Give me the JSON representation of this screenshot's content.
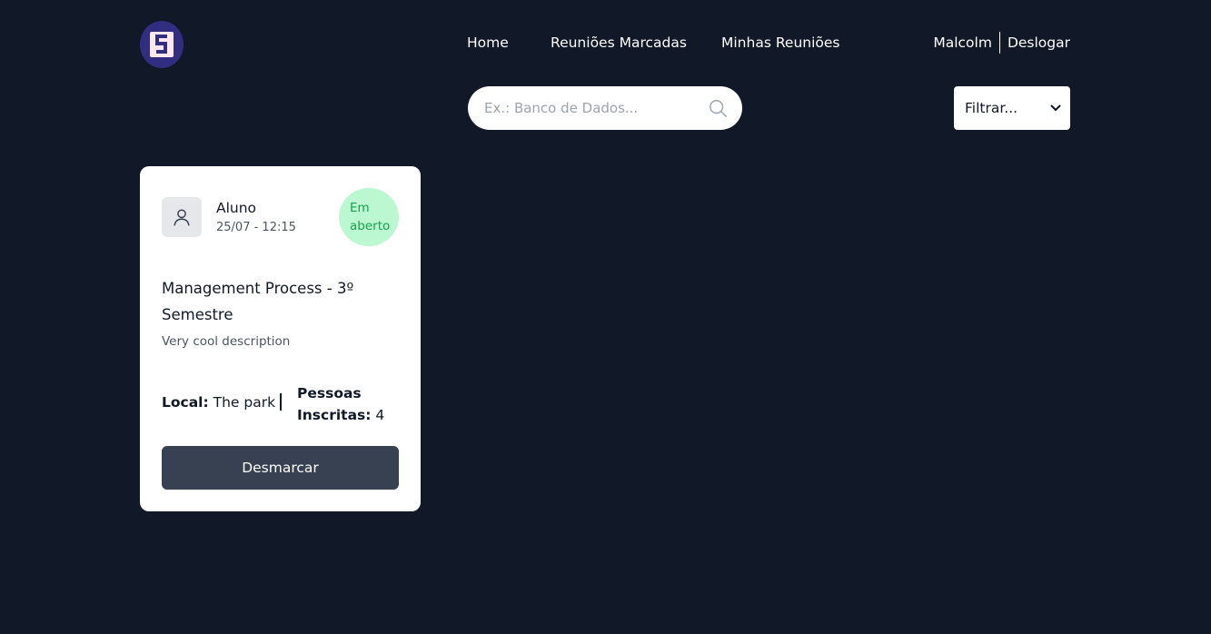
{
  "header": {
    "logo_icon": "app-logo",
    "nav": {
      "home": "Home",
      "booked": "Reuniões Marcadas",
      "my_meetings": "Minhas Reuniões"
    },
    "user_name": "Malcolm",
    "logout_label": "Deslogar"
  },
  "toolbar": {
    "search_placeholder": "Ex.: Banco de Dados...",
    "search_icon": "search-icon",
    "filter_selected": "Filtrar...",
    "filter_icon": "chevron-down-icon"
  },
  "meetings": [
    {
      "avatar_icon": "user-icon",
      "author": "Aluno",
      "datetime": "25/07 - 12:15",
      "status_line1": "Em",
      "status_line2": "aberto",
      "title": "Management Process - 3º Semestre",
      "description": "Very cool description",
      "local_label": "Local:",
      "local_value": "The park",
      "people_label": "Pessoas Inscritas:",
      "people_value": "4",
      "action_label": "Desmarcar"
    }
  ],
  "colors": {
    "background": "#111827",
    "card": "#ffffff",
    "button": "#374151",
    "status_bg": "#bbf7d0",
    "status_text": "#16a34a",
    "logo": "#312e81"
  }
}
